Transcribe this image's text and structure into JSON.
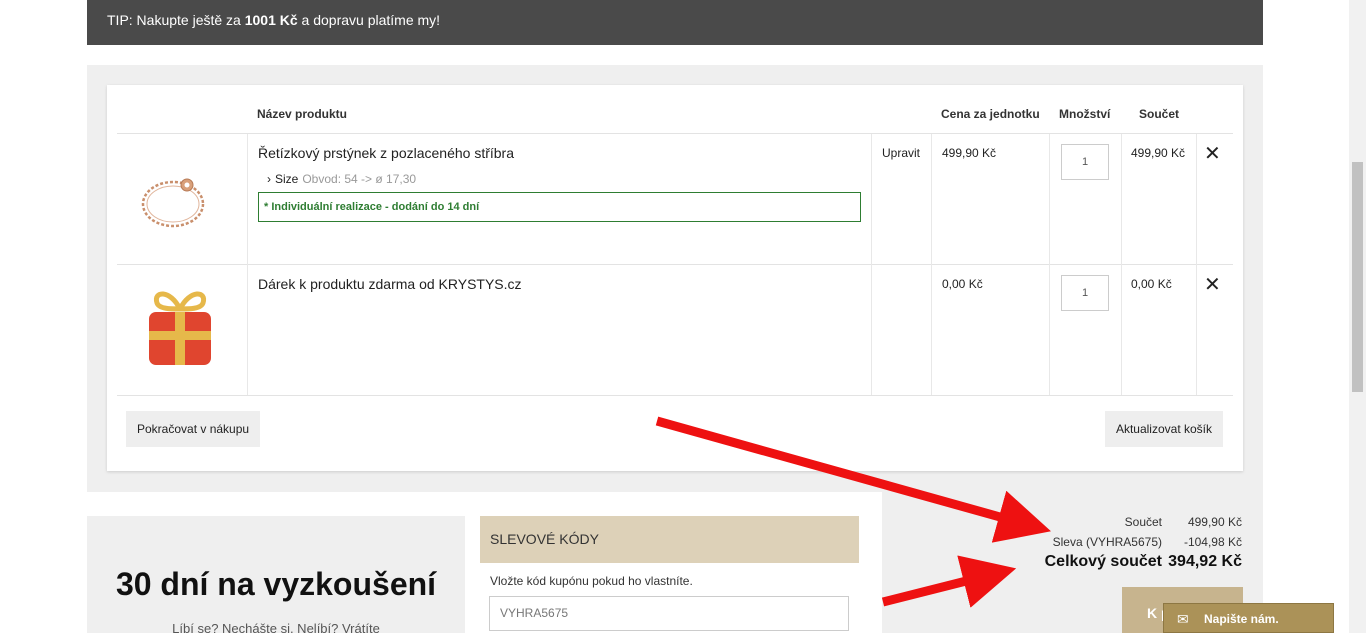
{
  "tip": {
    "prefix": "TIP: Nakupte ještě za ",
    "amount": "1001 Kč",
    "suffix": " a dopravu platíme my!"
  },
  "table": {
    "headers": {
      "name": "Název produktu",
      "unit_price": "Cena za jednotku",
      "qty": "Množství",
      "subtotal": "Součet"
    },
    "rows": [
      {
        "name": "Řetízkový prstýnek z pozlaceného stříbra",
        "option_label": "Size",
        "option_value": "Obvod: 54 -> ø 17,30",
        "notice": "* Individuální realizace - dodání do 14 dní",
        "edit": "Upravit",
        "unit_price": "499,90 Kč",
        "qty": "1",
        "subtotal": "499,90 Kč"
      },
      {
        "name": "Dárek k produktu zdarma od KRYSTYS.cz",
        "unit_price": "0,00 Kč",
        "qty": "1",
        "subtotal": "0,00 Kč"
      }
    ],
    "continue_label": "Pokračovat v nákupu",
    "update_label": "Aktualizovat košík"
  },
  "promo": {
    "title": "30 dní na vyzkoušení",
    "subtitle": "Líbí se? Nechášte si. Nelíbí? Vrátíte"
  },
  "codes": {
    "title": "SLEVOVÉ KÓDY",
    "label": "Vložte kód kupónu pokud ho vlastníte.",
    "input_value": "VYHRA5675"
  },
  "totals": {
    "subtotal_label": "Součet",
    "subtotal_value": "499,90 Kč",
    "discount_label": "Sleva (VYHRA5675)",
    "discount_value": "-104,98 Kč",
    "grand_label": "Celkový součet",
    "grand_value": "394,92 Kč"
  },
  "checkout_label": "K p",
  "chat_label": "Napište nám.",
  "colors": {
    "tip_bg": "#4a4a4a",
    "accent": "#c7b48e",
    "codes_bg": "#ddd1b8",
    "notice_green": "#2e7d32",
    "arrow_red": "#ee1111"
  }
}
